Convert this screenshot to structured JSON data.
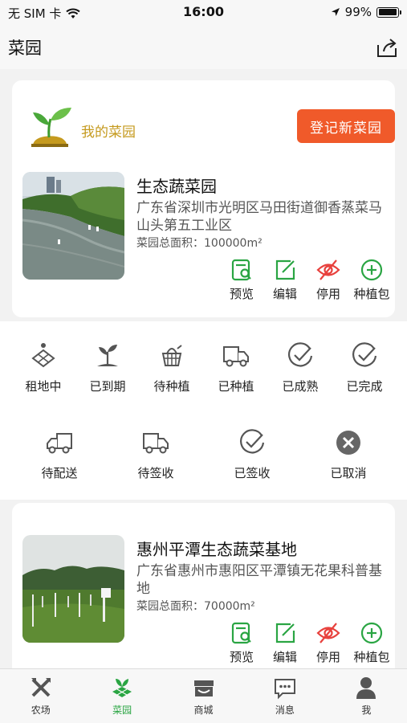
{
  "status_bar": {
    "carrier": "无 SIM 卡",
    "time": "16:00",
    "battery": "99%",
    "battery_level": 0.99
  },
  "nav": {
    "title": "菜园",
    "share_icon": "share-icon"
  },
  "header": {
    "label": "我的菜园",
    "register_button": "登记新菜园"
  },
  "gardens": [
    {
      "name": "生态蔬菜园",
      "address": "广东省深圳市光明区马田街道御香蒸菜马山头第五工业区",
      "area": "菜园总面积：100000m²"
    },
    {
      "name": "惠州平潭生态蔬菜基地",
      "address": "广东省惠州市惠阳区平潭镇无花果科普基地",
      "area": "菜园总面积：70000m²"
    }
  ],
  "actions": {
    "preview": "预览",
    "edit": "编辑",
    "disable": "停用",
    "package": "种植包"
  },
  "status_row_1": [
    "租地中",
    "已到期",
    "待种植",
    "已种植",
    "已成熟",
    "已完成"
  ],
  "status_row_2": [
    "待配送",
    "待签收",
    "已签收",
    "已取消"
  ],
  "tabs": [
    {
      "label": "农场",
      "icon": "farm-tools-icon"
    },
    {
      "label": "菜园",
      "icon": "garden-icon"
    },
    {
      "label": "商城",
      "icon": "store-icon"
    },
    {
      "label": "消息",
      "icon": "message-icon"
    },
    {
      "label": "我",
      "icon": "user-icon"
    }
  ],
  "active_tab": "菜园",
  "colors": {
    "accent_green": "#2aa543",
    "register_orange": "#f05a2a",
    "disable_red": "#e8413d",
    "header_gold": "#c59a1e"
  }
}
